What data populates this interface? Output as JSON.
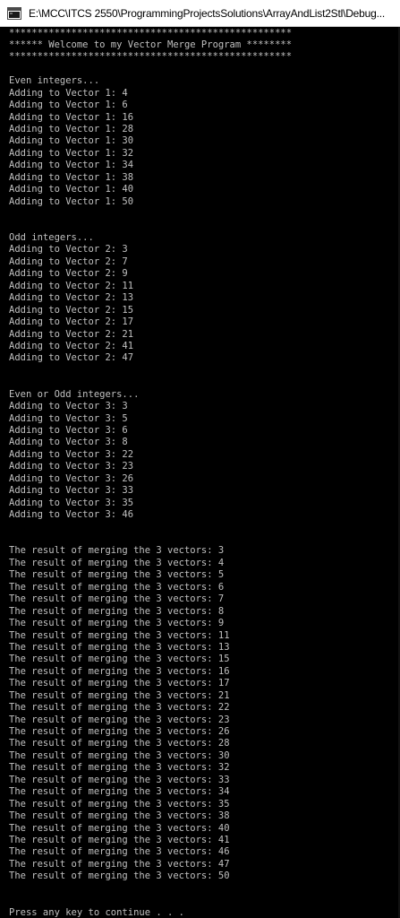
{
  "window": {
    "title": "E:\\MCC\\ITCS 2550\\ProgrammingProjectsSolutions\\ArrayAndList2Stl\\Debug..."
  },
  "console": {
    "text_color": "#c0c0c0",
    "background_color": "#000000",
    "lines": [
      "**************************************************",
      "****** Welcome to my Vector Merge Program ********",
      "**************************************************",
      "",
      "Even integers...",
      "Adding to Vector 1: 4",
      "Adding to Vector 1: 6",
      "Adding to Vector 1: 16",
      "Adding to Vector 1: 28",
      "Adding to Vector 1: 30",
      "Adding to Vector 1: 32",
      "Adding to Vector 1: 34",
      "Adding to Vector 1: 38",
      "Adding to Vector 1: 40",
      "Adding to Vector 1: 50",
      "",
      "",
      "Odd integers...",
      "Adding to Vector 2: 3",
      "Adding to Vector 2: 7",
      "Adding to Vector 2: 9",
      "Adding to Vector 2: 11",
      "Adding to Vector 2: 13",
      "Adding to Vector 2: 15",
      "Adding to Vector 2: 17",
      "Adding to Vector 2: 21",
      "Adding to Vector 2: 41",
      "Adding to Vector 2: 47",
      "",
      "",
      "Even or Odd integers...",
      "Adding to Vector 3: 3",
      "Adding to Vector 3: 5",
      "Adding to Vector 3: 6",
      "Adding to Vector 3: 8",
      "Adding to Vector 3: 22",
      "Adding to Vector 3: 23",
      "Adding to Vector 3: 26",
      "Adding to Vector 3: 33",
      "Adding to Vector 3: 35",
      "Adding to Vector 3: 46",
      "",
      "",
      "The result of merging the 3 vectors: 3",
      "The result of merging the 3 vectors: 4",
      "The result of merging the 3 vectors: 5",
      "The result of merging the 3 vectors: 6",
      "The result of merging the 3 vectors: 7",
      "The result of merging the 3 vectors: 8",
      "The result of merging the 3 vectors: 9",
      "The result of merging the 3 vectors: 11",
      "The result of merging the 3 vectors: 13",
      "The result of merging the 3 vectors: 15",
      "The result of merging the 3 vectors: 16",
      "The result of merging the 3 vectors: 17",
      "The result of merging the 3 vectors: 21",
      "The result of merging the 3 vectors: 22",
      "The result of merging the 3 vectors: 23",
      "The result of merging the 3 vectors: 26",
      "The result of merging the 3 vectors: 28",
      "The result of merging the 3 vectors: 30",
      "The result of merging the 3 vectors: 32",
      "The result of merging the 3 vectors: 33",
      "The result of merging the 3 vectors: 34",
      "The result of merging the 3 vectors: 35",
      "The result of merging the 3 vectors: 38",
      "The result of merging the 3 vectors: 40",
      "The result of merging the 3 vectors: 41",
      "The result of merging the 3 vectors: 46",
      "The result of merging the 3 vectors: 47",
      "The result of merging the 3 vectors: 50",
      "",
      "",
      "Press any key to continue . . ."
    ]
  }
}
